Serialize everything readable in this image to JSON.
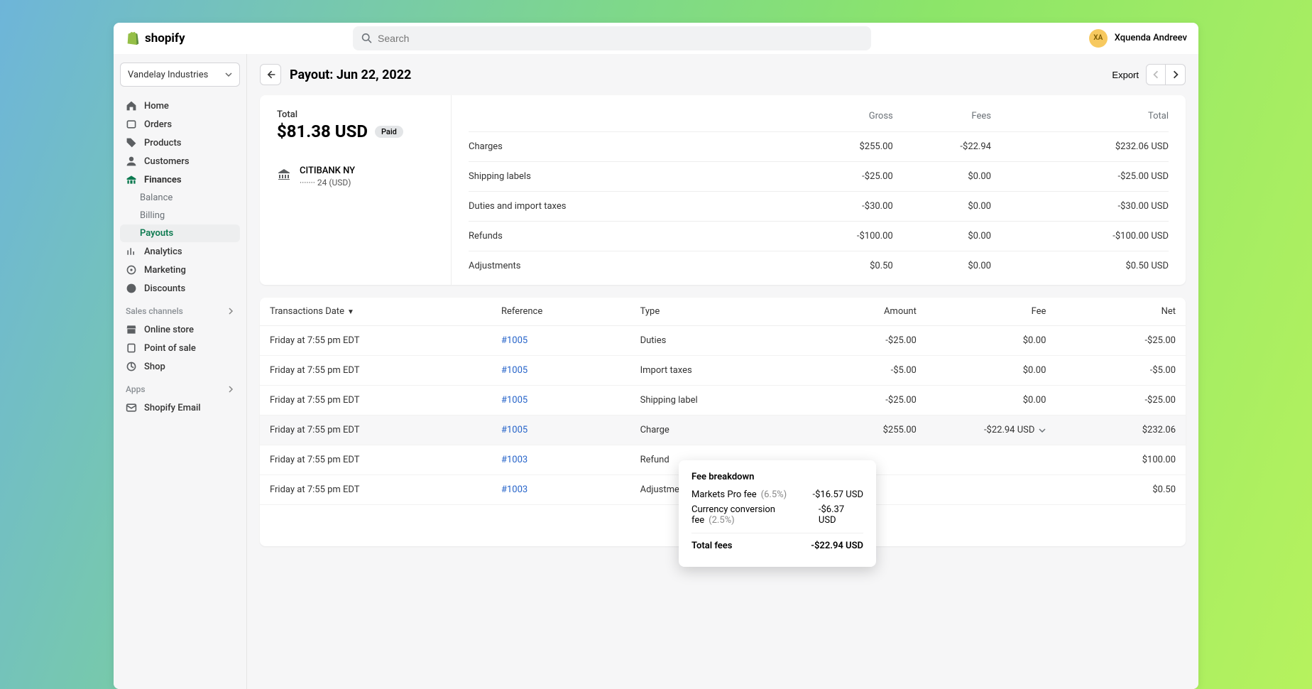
{
  "brand": "shopify",
  "search_placeholder": "Search",
  "user": {
    "initials": "XA",
    "name": "Xquenda Andreev"
  },
  "store_name": "Vandelay Industries",
  "nav": {
    "home": "Home",
    "orders": "Orders",
    "products": "Products",
    "customers": "Customers",
    "finances": "Finances",
    "balance": "Balance",
    "billing": "Billing",
    "payouts": "Payouts",
    "analytics": "Analytics",
    "marketing": "Marketing",
    "discounts": "Discounts",
    "sales_label": "Sales channels",
    "online_store": "Online store",
    "pos": "Point of sale",
    "shop": "Shop",
    "apps_label": "Apps",
    "shopify_email": "Shopify Email"
  },
  "page": {
    "title": "Payout: Jun 22, 2022",
    "export": "Export"
  },
  "summary": {
    "total_label": "Total",
    "total_amount": "$81.38 USD",
    "status": "Paid",
    "bank_name": "CITIBANK NY",
    "bank_acc": "······· 24  (USD)",
    "headers": {
      "gross": "Gross",
      "fees": "Fees",
      "total": "Total"
    },
    "rows": [
      {
        "label": "Charges",
        "gross": "$255.00",
        "fees": "-$22.94",
        "total": "$232.06 USD"
      },
      {
        "label": "Shipping labels",
        "gross": "-$25.00",
        "fees": "$0.00",
        "total": "-$25.00 USD"
      },
      {
        "label": "Duties and import taxes",
        "gross": "-$30.00",
        "fees": "$0.00",
        "total": "-$30.00 USD"
      },
      {
        "label": "Refunds",
        "gross": "-$100.00",
        "fees": "$0.00",
        "total": "-$100.00 USD"
      },
      {
        "label": "Adjustments",
        "gross": "$0.50",
        "fees": "$0.00",
        "total": "$0.50 USD"
      }
    ]
  },
  "transactions": {
    "headers": {
      "date": "Transactions Date",
      "ref": "Reference",
      "type": "Type",
      "amount": "Amount",
      "fee": "Fee",
      "net": "Net"
    },
    "rows": [
      {
        "date": "Friday at 7:55 pm EDT",
        "ref": "#1005",
        "type": "Duties",
        "amount": "-$25.00",
        "fee": "$0.00",
        "net": "-$25.00"
      },
      {
        "date": "Friday at 7:55 pm EDT",
        "ref": "#1005",
        "type": "Import taxes",
        "amount": "-$5.00",
        "fee": "$0.00",
        "net": "-$5.00"
      },
      {
        "date": "Friday at 7:55 pm EDT",
        "ref": "#1005",
        "type": "Shipping label",
        "amount": "-$25.00",
        "fee": "$0.00",
        "net": "-$25.00"
      },
      {
        "date": "Friday at 7:55 pm EDT",
        "ref": "#1005",
        "type": "Charge",
        "amount": "$255.00",
        "fee": "-$22.94 USD",
        "net": "$232.06",
        "hov": true
      },
      {
        "date": "Friday at 7:55 pm EDT",
        "ref": "#1003",
        "type": "Refund",
        "amount": "",
        "fee": "",
        "net": "$100.00"
      },
      {
        "date": "Friday at 7:55 pm EDT",
        "ref": "#1003",
        "type": "Adjustment",
        "amount": "",
        "fee": "",
        "net": "$0.50"
      }
    ]
  },
  "popover": {
    "title": "Fee breakdown",
    "rows": [
      {
        "label": "Markets Pro fee",
        "pct": "(6.5%)",
        "val": "-$16.57 USD"
      },
      {
        "label": "Currency conversion fee",
        "pct": "(2.5%)",
        "val": "-$6.37 USD"
      }
    ],
    "total_label": "Total fees",
    "total_val": "-$22.94 USD"
  }
}
